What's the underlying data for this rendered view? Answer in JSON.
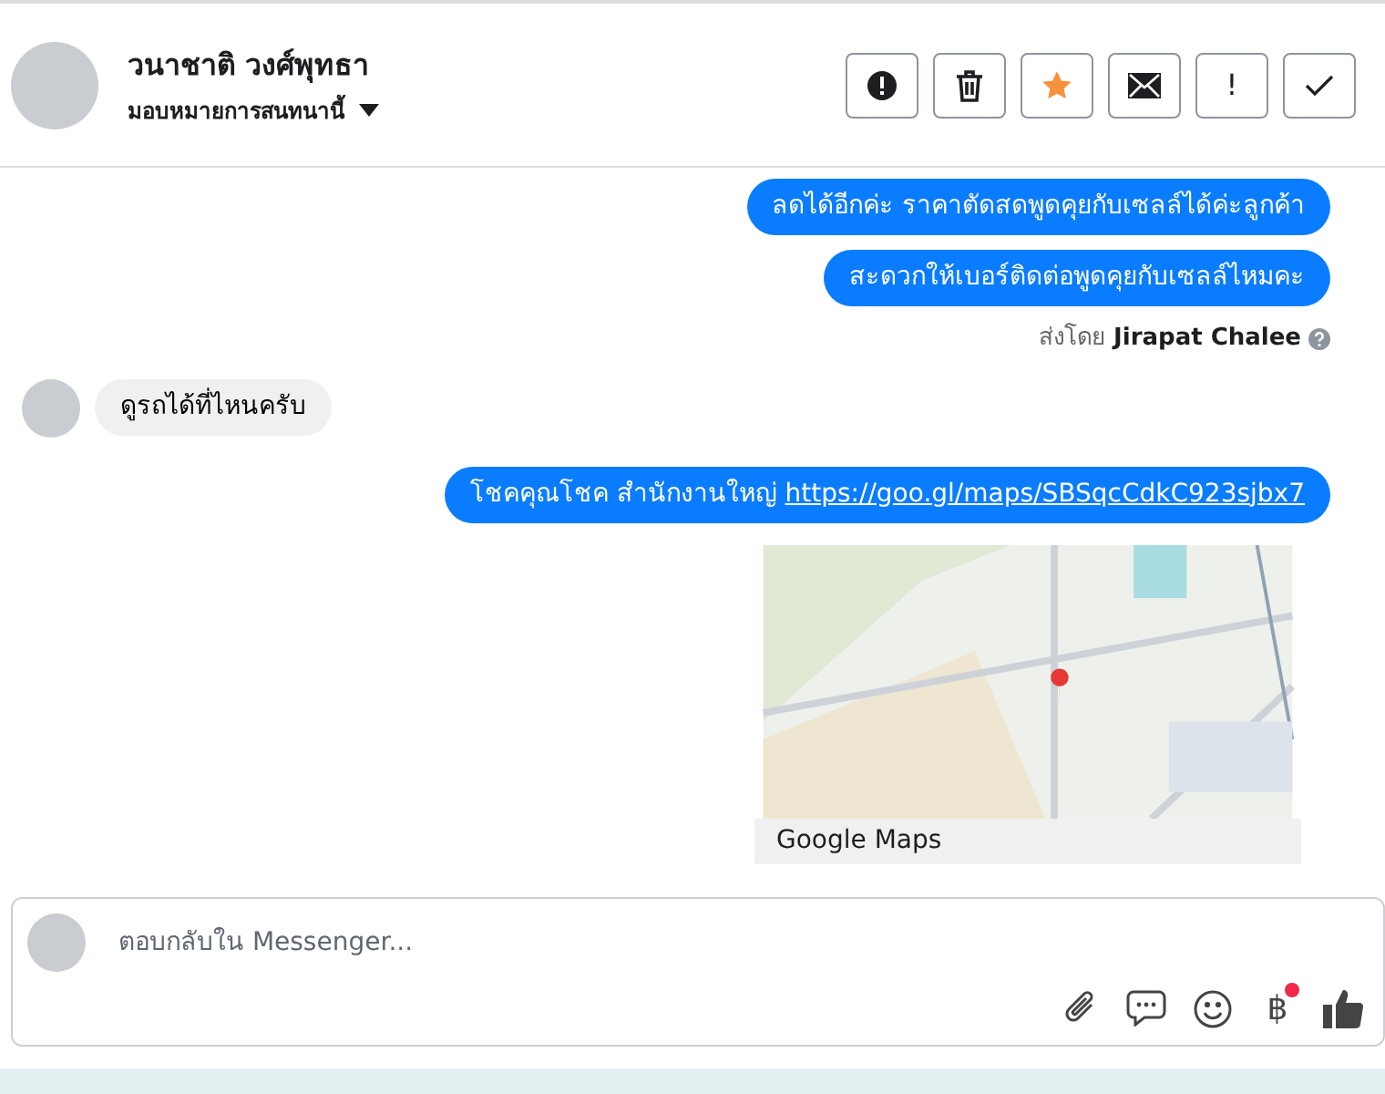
{
  "header": {
    "name": "วนาชาติ วงศ์พุทธา",
    "assign_label": "มอบหมายการสนทนานี้",
    "actions": [
      {
        "kind": "alert"
      },
      {
        "kind": "trash"
      },
      {
        "kind": "star"
      },
      {
        "kind": "mail"
      },
      {
        "kind": "text",
        "label": "!"
      },
      {
        "kind": "check"
      }
    ]
  },
  "messages": [
    {
      "kind": "outgoing",
      "text": "ลดได้อีกค่ะ ราคาตัดสดพูดคุยกับเซลล์ได้ค่ะลูกค้า"
    },
    {
      "kind": "outgoing",
      "text": "สะดวกให้เบอร์ติดต่อพูดคุยกับเซลล์ไหมคะ"
    },
    {
      "kind": "sender",
      "text": "ส่งโดย **Jirapat Chalee**"
    },
    {
      "kind": "incoming",
      "text": "ดูรถได้ที่ไหนครับ"
    },
    {
      "kind": "outgoing",
      "text": "โชคคุณโชค สำนักงานใหญ่",
      "link": "https://goo.gl/maps/SBSqcCdkC923sjbx7"
    },
    {
      "kind": "map",
      "caption": "Google Maps"
    }
  ],
  "composer": {
    "placeholder": "ตอบกลับใน Messenger...",
    "tools": [
      {
        "kind": "clip"
      },
      {
        "kind": "chat"
      },
      {
        "kind": "smile"
      },
      {
        "kind": "text",
        "label": "฿",
        "notification": true
      },
      {
        "kind": "like"
      }
    ]
  }
}
